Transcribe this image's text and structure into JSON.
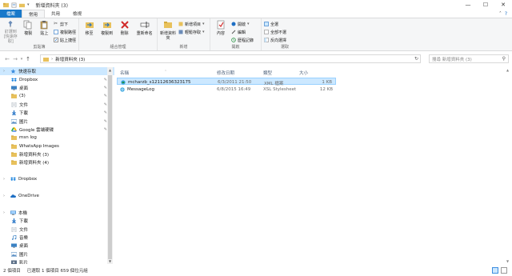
{
  "window": {
    "title": "新增資料夾 (3)",
    "controls": [
      "—",
      "☐",
      "✕"
    ]
  },
  "tabs": [
    {
      "label": "檔案"
    },
    {
      "label": "常用"
    },
    {
      "label": "共用"
    },
    {
      "label": "檢視"
    }
  ],
  "ribbon": {
    "clipboard": {
      "label": "剪貼簿",
      "pin": "釘選到 [快速存取]",
      "copy": "複製",
      "paste": "貼上",
      "cut": "剪下",
      "copy_path": "複製路徑",
      "paste_shortcut": "貼上捷徑"
    },
    "organize": {
      "label": "組合管理",
      "move_to": "移至",
      "copy_to": "複製到",
      "delete": "刪除",
      "rename": "重新命名"
    },
    "new": {
      "label": "新增",
      "new_folder": "新增資料夾",
      "new_item": "新增項目",
      "easy_access": "輕鬆存取"
    },
    "open": {
      "label": "開啟",
      "properties": "內容",
      "open": "開啟",
      "edit": "編輯",
      "history": "歷程記錄"
    },
    "select": {
      "label": "選取",
      "select_all": "全選",
      "select_none": "全部不選",
      "invert": "反向選擇"
    }
  },
  "address": {
    "path": "新增資料夾 (3)",
    "search_placeholder": "搜尋 新增資料夾 (3)"
  },
  "nav": [
    {
      "label": "快速存取",
      "type": "head",
      "selected": true,
      "icon": "star-icon",
      "color": "#3d8ee0"
    },
    {
      "label": "Dropbox",
      "pin": true,
      "icon": "dropbox-icon",
      "color": "#0a7bdc"
    },
    {
      "label": "桌面",
      "pin": true,
      "icon": "desktop-icon",
      "color": "#3b82c4"
    },
    {
      "label": "(3)",
      "pin": true,
      "icon": "folder-icon",
      "color": "#e8c15c"
    },
    {
      "label": "文件",
      "pin": true,
      "icon": "documents-icon",
      "color": "#9aa4b0"
    },
    {
      "label": "下載",
      "pin": true,
      "icon": "download-icon",
      "color": "#1e6fc4"
    },
    {
      "label": "圖片",
      "pin": true,
      "icon": "pictures-icon",
      "color": "#5a8fc4"
    },
    {
      "label": "Google 雲端硬碟",
      "pin": true,
      "icon": "google-drive-icon",
      "color": "#34a853"
    },
    {
      "label": "msn log",
      "icon": "folder-icon",
      "color": "#e8c15c"
    },
    {
      "label": "WhatsApp Images",
      "icon": "folder-icon",
      "color": "#e8c15c"
    },
    {
      "label": "新增資料夾 (3)",
      "icon": "folder-icon",
      "color": "#e8c15c"
    },
    {
      "label": "新增資料夾 (4)",
      "icon": "folder-icon",
      "color": "#e8c15c"
    },
    {
      "label": "",
      "type": "spacer"
    },
    {
      "label": "Dropbox",
      "type": "head",
      "icon": "dropbox-icon",
      "color": "#0a7bdc"
    },
    {
      "label": "",
      "type": "spacer"
    },
    {
      "label": "OneDrive",
      "type": "head",
      "icon": "onedrive-icon",
      "color": "#1e6fc4"
    },
    {
      "label": "",
      "type": "spacer"
    },
    {
      "label": "本機",
      "type": "head",
      "icon": "computer-icon",
      "color": "#3b82c4"
    },
    {
      "label": "下載",
      "icon": "download-icon",
      "color": "#1e6fc4"
    },
    {
      "label": "文件",
      "icon": "documents-icon",
      "color": "#9aa4b0"
    },
    {
      "label": "音樂",
      "icon": "music-icon",
      "color": "#3b82c4"
    },
    {
      "label": "桌面",
      "icon": "desktop-icon",
      "color": "#3b82c4"
    },
    {
      "label": "圖片",
      "icon": "pictures-icon",
      "color": "#5a8fc4"
    },
    {
      "label": "影片",
      "icon": "videos-icon",
      "color": "#5a6e86"
    }
  ],
  "columns": {
    "name": "名稱",
    "date": "修改日期",
    "type": "類型",
    "size": "大小"
  },
  "files": [
    {
      "name": "mcharzb_s12112636323175",
      "date": "6/3/2011 21:50",
      "type": "XML 檔案",
      "size": "1 KB",
      "selected": true,
      "icon": "xml-file-icon"
    },
    {
      "name": "MessageLog",
      "date": "6/8/2015 16:49",
      "type": "XSL Stylesheet",
      "size": "12 KB",
      "selected": false,
      "icon": "xsl-file-icon"
    }
  ],
  "status": {
    "count": "2 個項目",
    "selected": "已選取 1 個項目 659 個位元組"
  },
  "colors": {
    "accent": "#1979ca",
    "selection": "#cce8ff",
    "selection_border": "#99d1ff"
  }
}
